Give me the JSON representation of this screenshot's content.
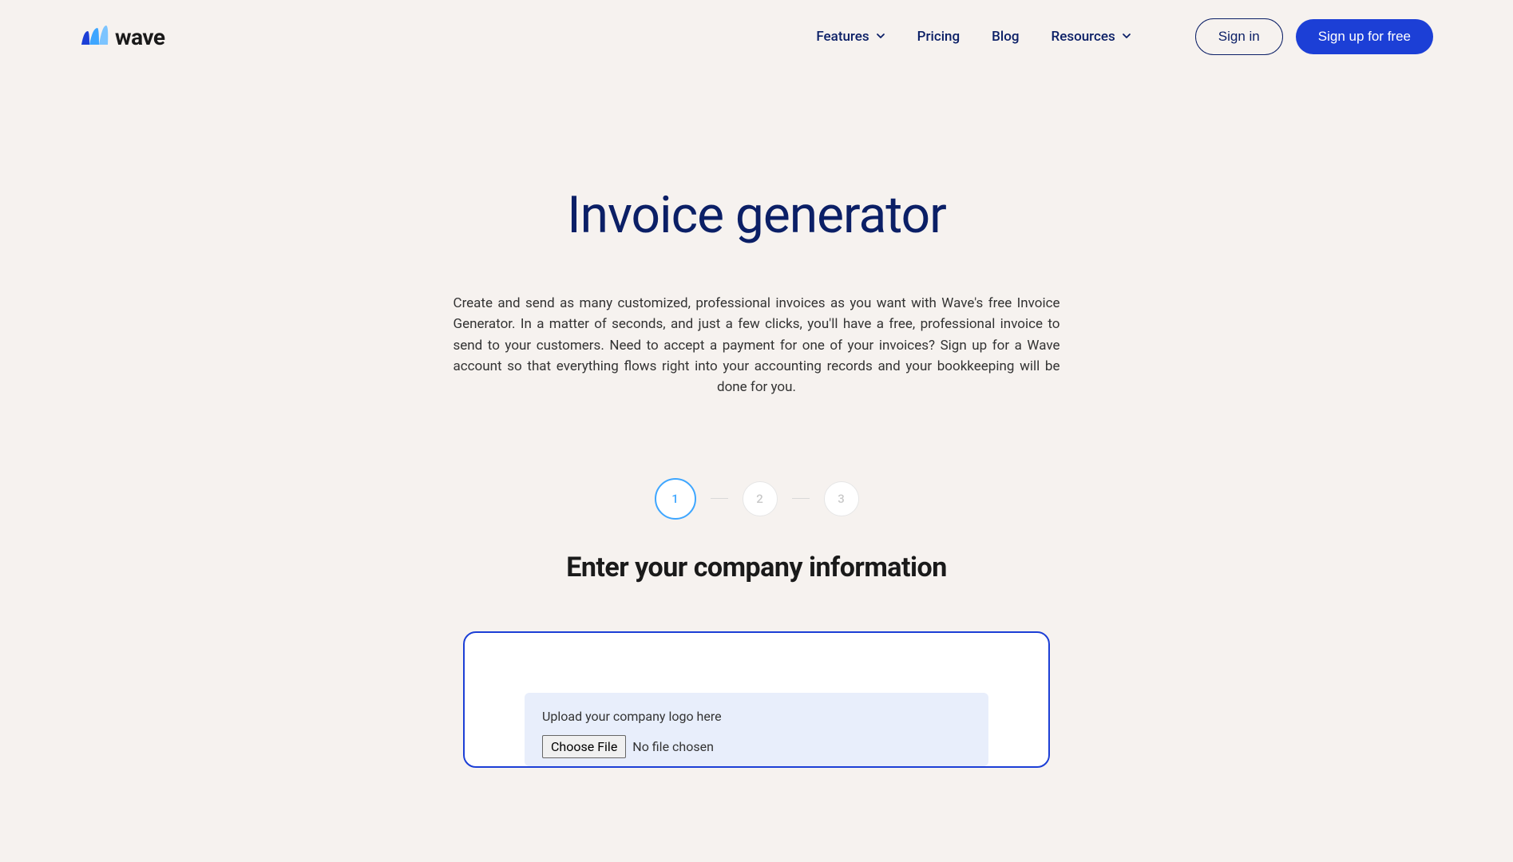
{
  "brand": {
    "name": "wave"
  },
  "nav": {
    "features": "Features",
    "pricing": "Pricing",
    "blog": "Blog",
    "resources": "Resources"
  },
  "auth": {
    "signin": "Sign in",
    "signup": "Sign up for free"
  },
  "hero": {
    "title": "Invoice generator",
    "description": "Create and send as many customized, professional invoices as you want with Wave's free Invoice Generator. In a matter of seconds, and just a few clicks, you'll have a free, professional invoice to send to your customers. Need to accept a payment for one of your invoices? Sign up for a Wave account so that everything flows right into your accounting records and your bookkeeping will be done for you."
  },
  "steps": {
    "s1": "1",
    "s2": "2",
    "s3": "3"
  },
  "section": {
    "title": "Enter your company information"
  },
  "upload": {
    "label": "Upload your company logo here",
    "button": "Choose File",
    "status": "No file chosen"
  }
}
